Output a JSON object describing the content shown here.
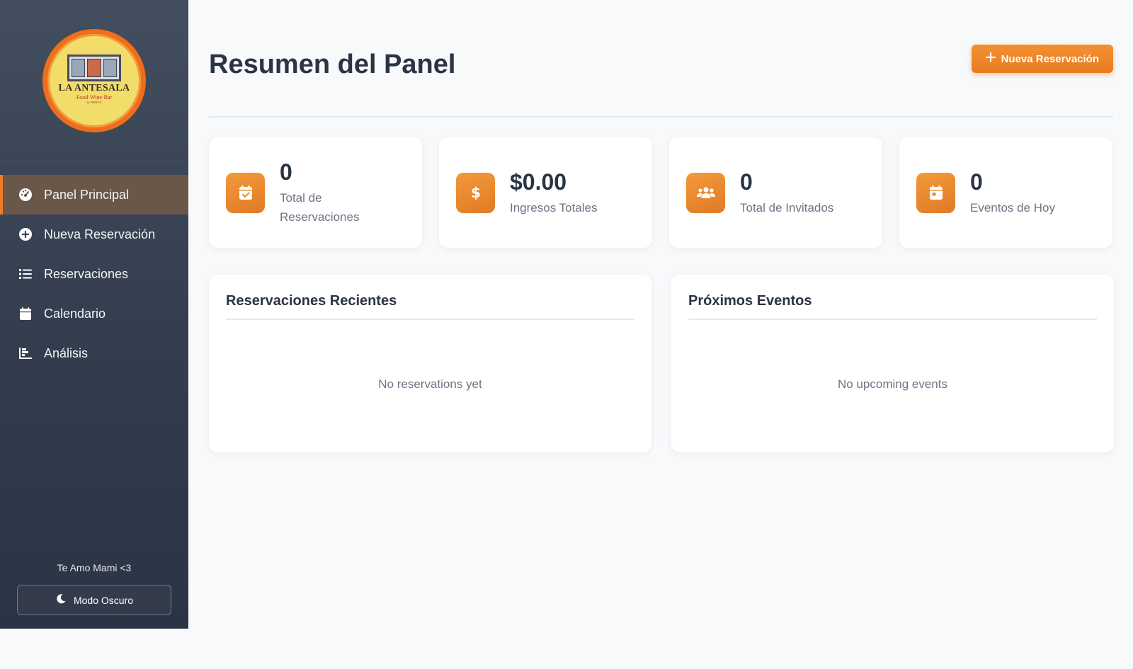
{
  "brand": {
    "name": "LA ANTESALA",
    "tagline": "Food·Wine·Bar",
    "small_print": "by FERRUA"
  },
  "sidebar": {
    "items": [
      {
        "label": "Panel Principal",
        "icon": "dashboard-icon",
        "active": true
      },
      {
        "label": "Nueva Reservación",
        "icon": "plus-circle-icon",
        "active": false
      },
      {
        "label": "Reservaciones",
        "icon": "list-icon",
        "active": false
      },
      {
        "label": "Calendario",
        "icon": "calendar-icon",
        "active": false
      },
      {
        "label": "Análisis",
        "icon": "chart-icon",
        "active": false
      }
    ],
    "footer_text": "Te Amo Mami <3",
    "dark_mode_label": "Modo Oscuro"
  },
  "header": {
    "title": "Resumen del Panel",
    "new_reservation_label": "Nueva Reservación"
  },
  "stats": [
    {
      "value": "0",
      "label": "Total de Reservaciones",
      "icon": "calendar-check-icon"
    },
    {
      "value": "$0.00",
      "label": "Ingresos Totales",
      "icon": "dollar-icon"
    },
    {
      "value": "0",
      "label": "Total de Invitados",
      "icon": "users-icon"
    },
    {
      "value": "0",
      "label": "Eventos de Hoy",
      "icon": "calendar-day-icon"
    }
  ],
  "panels": {
    "recent": {
      "title": "Reservaciones Recientes",
      "empty": "No reservations yet"
    },
    "upcoming": {
      "title": "Próximos Eventos",
      "empty": "No upcoming events"
    }
  },
  "colors": {
    "accent": "#ee7c2a",
    "sidebar": "#3b4555",
    "background": "#f8f9fb"
  }
}
